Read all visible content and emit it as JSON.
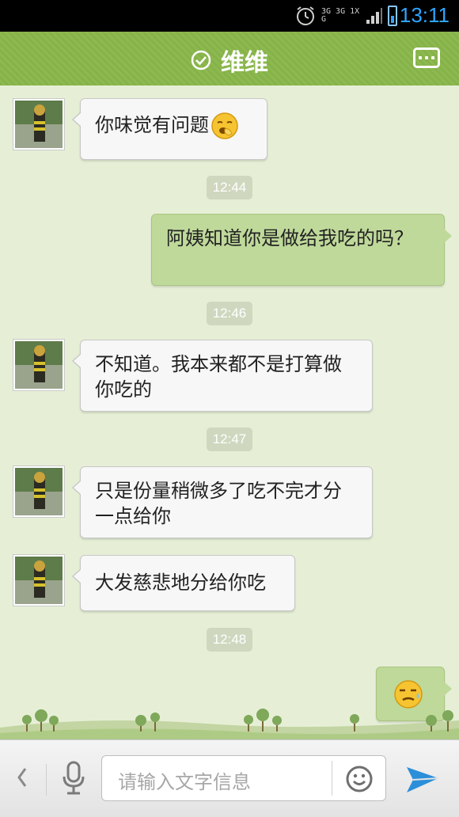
{
  "status_bar": {
    "network_text": "3G 3G 1X G",
    "time": "13:11"
  },
  "header": {
    "title": "维维",
    "status_icon": "verified-check-icon",
    "menu_icon": "more-dots-icon"
  },
  "messages": [
    {
      "side": "in",
      "text": "你味觉有问题",
      "emoji": "yawn-emoji-icon"
    },
    {
      "side": "timestamp",
      "text": "12:44"
    },
    {
      "side": "out",
      "text": "阿姨知道你是做给我吃的吗？"
    },
    {
      "side": "timestamp",
      "text": "12:46"
    },
    {
      "side": "in",
      "text": "不知道。我本来都不是打算做你吃的"
    },
    {
      "side": "timestamp",
      "text": "12:47"
    },
    {
      "side": "in",
      "text": "只是份量稍微多了吃不完才分一点给你"
    },
    {
      "side": "in",
      "text": "大发慈悲地分给你吃"
    },
    {
      "side": "timestamp",
      "text": "12:48"
    },
    {
      "side": "out",
      "text": "",
      "emoji": "sweat-emoji-icon"
    }
  ],
  "input_bar": {
    "placeholder": "请输入文字信息",
    "icons": [
      "back-chevron-icon",
      "microphone-icon",
      "smiley-icon",
      "send-icon"
    ]
  },
  "colors": {
    "header_green": "#8cb950",
    "chat_background": "#e6efd6",
    "outgoing_bubble": "#bfd99a",
    "incoming_bubble": "#f7f7f7",
    "status_time_blue": "#2ea6ff"
  }
}
